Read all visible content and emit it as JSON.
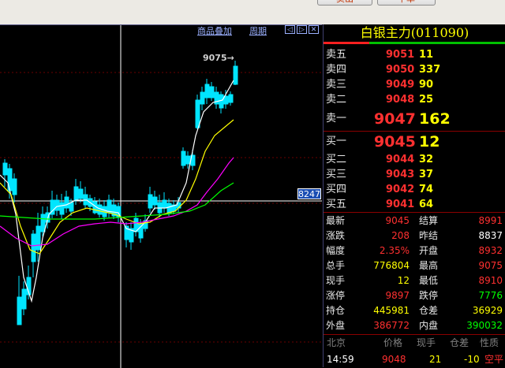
{
  "top_buttons": {
    "sell": "卖出",
    "buy": "下单"
  },
  "chart": {
    "link_goods": "商品叠加",
    "link_period": "周期",
    "icon_labels": [
      "◁",
      "▷",
      "✕"
    ],
    "current_price_tag": "8247",
    "peak_label": "9075→",
    "colors": {
      "up": "#ff3b3b",
      "down": "#00e5ff",
      "ma5": "#ffffff",
      "ma10": "#ffff00",
      "ma20": "#ff00ff",
      "ma60": "#00ff00"
    }
  },
  "panel": {
    "title": "白银主力(011090)",
    "asks": [
      {
        "label": "卖五",
        "price": "9051",
        "vol": "11"
      },
      {
        "label": "卖四",
        "price": "9050",
        "vol": "337"
      },
      {
        "label": "卖三",
        "price": "9049",
        "vol": "90"
      },
      {
        "label": "卖二",
        "price": "9048",
        "vol": "25"
      },
      {
        "label": "卖一",
        "price": "9047",
        "vol": "162"
      }
    ],
    "bids": [
      {
        "label": "买一",
        "price": "9045",
        "vol": "12"
      },
      {
        "label": "买二",
        "price": "9044",
        "vol": "32"
      },
      {
        "label": "买三",
        "price": "9043",
        "vol": "37"
      },
      {
        "label": "买四",
        "price": "9042",
        "vol": "74"
      },
      {
        "label": "买五",
        "price": "9041",
        "vol": "64"
      }
    ],
    "stats": [
      {
        "l1": "最新",
        "v1": "9045",
        "c1": "red",
        "l2": "结算",
        "v2": "8991",
        "c2": "red"
      },
      {
        "l1": "涨跌",
        "v1": "208",
        "c1": "red",
        "l2": "昨结",
        "v2": "8837",
        "c2": "white"
      },
      {
        "l1": "幅度",
        "v1": "2.35%",
        "c1": "red",
        "l2": "开盘",
        "v2": "8932",
        "c2": "red"
      },
      {
        "l1": "总手",
        "v1": "776804",
        "c1": "yellow",
        "l2": "最高",
        "v2": "9075",
        "c2": "red"
      },
      {
        "l1": "现手",
        "v1": "12",
        "c1": "yellow",
        "l2": "最低",
        "v2": "8910",
        "c2": "red"
      },
      {
        "l1": "涨停",
        "v1": "9897",
        "c1": "red",
        "l2": "跌停",
        "v2": "7776",
        "c2": "green"
      },
      {
        "l1": "持仓",
        "v1": "445981",
        "c1": "yellow",
        "l2": "仓差",
        "v2": "36929",
        "c2": "yellow"
      },
      {
        "l1": "外盘",
        "v1": "386772",
        "c1": "red",
        "l2": "内盘",
        "v2": "390032",
        "c2": "green"
      }
    ],
    "tick_header": [
      "北京",
      "价格",
      "现手",
      "仓差",
      "性质"
    ],
    "tick_row": {
      "time": "14:59",
      "price": "9048",
      "vol": "21",
      "diff": "-10",
      "nature": "空平"
    }
  }
}
